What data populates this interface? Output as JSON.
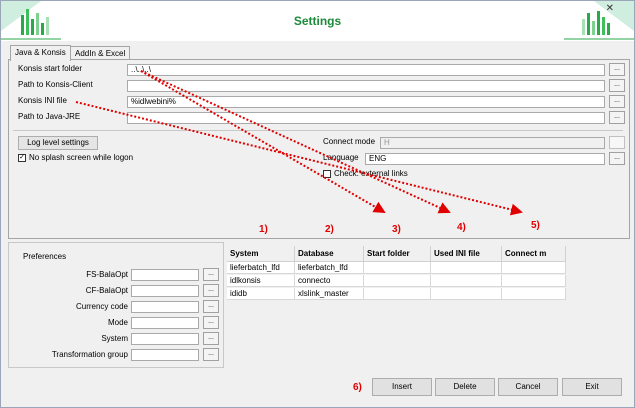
{
  "window": {
    "title": "Settings",
    "close_label": "✕"
  },
  "colors": {
    "title": "#1c8a3b",
    "annotation": "#e00000",
    "logo_green": "#2aa84a"
  },
  "tabs": [
    {
      "label": "Java & Konsis",
      "active": true
    },
    {
      "label": "AddIn & Excel",
      "active": false
    }
  ],
  "java_tab": {
    "fields": [
      {
        "label": "Konsis start folder",
        "value": "..\\..\\..\\"
      },
      {
        "label": "Path to Konsis-Client",
        "value": ""
      },
      {
        "label": "Konsis INI file",
        "value": "%idlwebini%"
      },
      {
        "label": "Path to Java-JRE",
        "value": ""
      }
    ],
    "log_level_button": "Log level settings",
    "no_splash_label": "No splash screen while logon",
    "no_splash_checked": true,
    "connect_mode_label": "Connect mode",
    "connect_mode_value": "H",
    "language_label": "Language",
    "language_value": "ENG",
    "check_external_label": "Check: external links",
    "check_external_checked": false,
    "browse_label": "..."
  },
  "annotations": [
    "1)",
    "2)",
    "3)",
    "4)",
    "5)",
    "6)"
  ],
  "preferences": {
    "title": "Preferences",
    "items": [
      {
        "label": "FS-BalaOpt",
        "value": ""
      },
      {
        "label": "CF-BalaOpt",
        "value": ""
      },
      {
        "label": "Currency code",
        "value": ""
      },
      {
        "label": "Mode",
        "value": ""
      },
      {
        "label": "System",
        "value": ""
      },
      {
        "label": "Transformation group",
        "value": ""
      }
    ]
  },
  "systems_table": {
    "columns": [
      "System",
      "Database",
      "Start folder",
      "Used INI file",
      "Connect m"
    ],
    "rows": [
      [
        "lieferbatch_lfd",
        "lieferbatch_lfd",
        "",
        "",
        ""
      ],
      [
        "idlkonsis",
        "connecto",
        "",
        "",
        ""
      ],
      [
        "ididb",
        "xlslink_master",
        "",
        "",
        ""
      ]
    ]
  },
  "buttons": {
    "insert": "Insert",
    "delete": "Delete",
    "cancel": "Cancel",
    "exit": "Exit"
  }
}
